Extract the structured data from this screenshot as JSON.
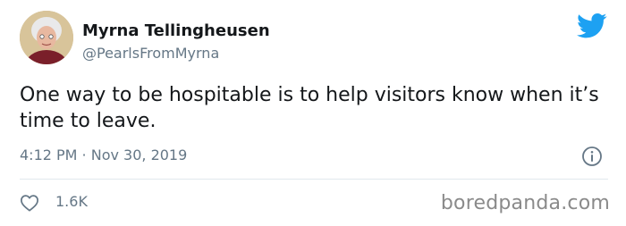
{
  "author": {
    "display_name": "Myrna Tellingheusen",
    "handle": "@PearlsFromMyrna"
  },
  "tweet": {
    "text": "One way to be hospitable is to help visitors know when it’s time to leave.",
    "timestamp": "4:12 PM · Nov 30, 2019",
    "likes": "1.6K"
  },
  "icons": {
    "brand": "twitter-bird-icon",
    "info": "info-icon",
    "like": "heart-icon"
  },
  "watermark": "boredpanda.com",
  "colors": {
    "twitter_blue": "#1da1f2",
    "secondary_text": "#657786",
    "primary_text": "#14171a",
    "divider": "#e1e8ed"
  }
}
